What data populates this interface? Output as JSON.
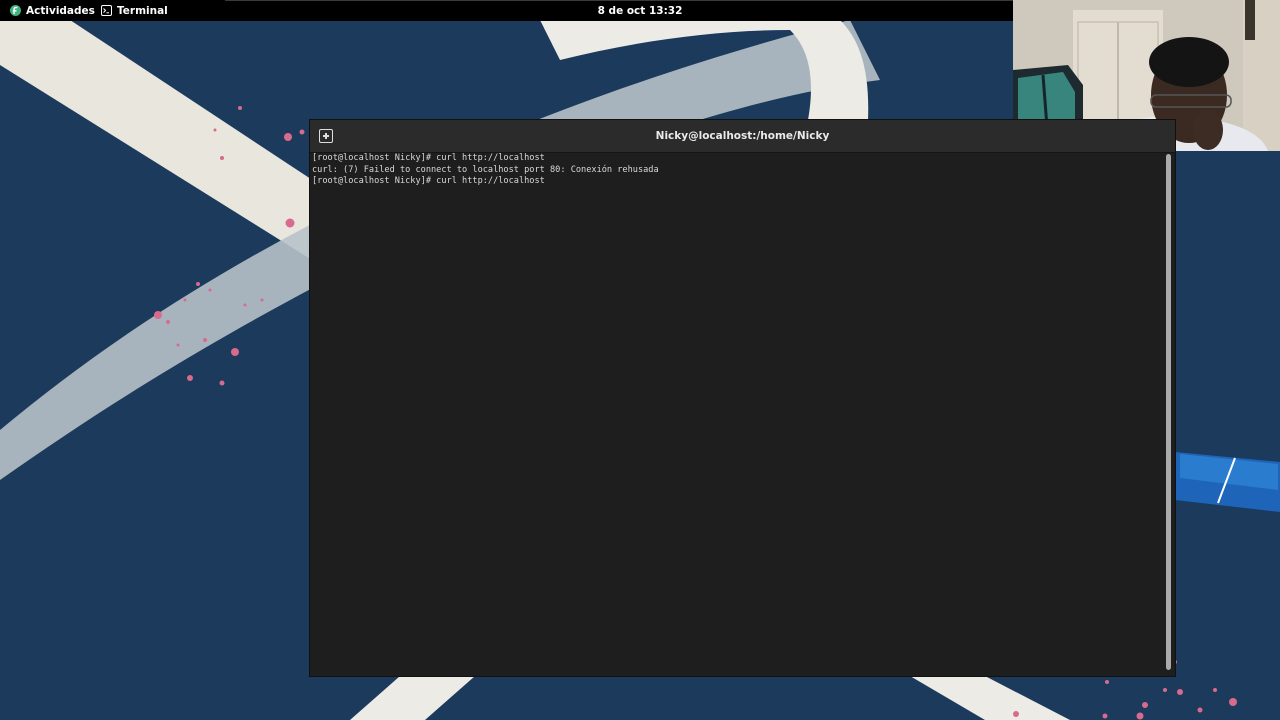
{
  "topbar": {
    "activities_label": "Actividades",
    "app_label": "Terminal",
    "clock": "8 de oct  13:32"
  },
  "terminal": {
    "title": "Nicky@localhost:/home/Nicky",
    "lines": [
      "[root@localhost Nicky]# curl http://localhost",
      "curl: (7) Failed to connect to localhost port 80: Conexión rehusada",
      "[root@localhost Nicky]# curl http://localhost"
    ]
  },
  "colors": {
    "wallpaper_bg": "#1c3a5c",
    "wallpaper_band": "#eae8e1",
    "wallpaper_dots": "#d86a8e",
    "terminal_bg": "#1e1e1e",
    "terminal_header": "#2b2b2b"
  },
  "icons": {
    "activities": "fedora-logo-icon",
    "app": "terminal-icon",
    "new_tab": "new-tab-icon"
  }
}
